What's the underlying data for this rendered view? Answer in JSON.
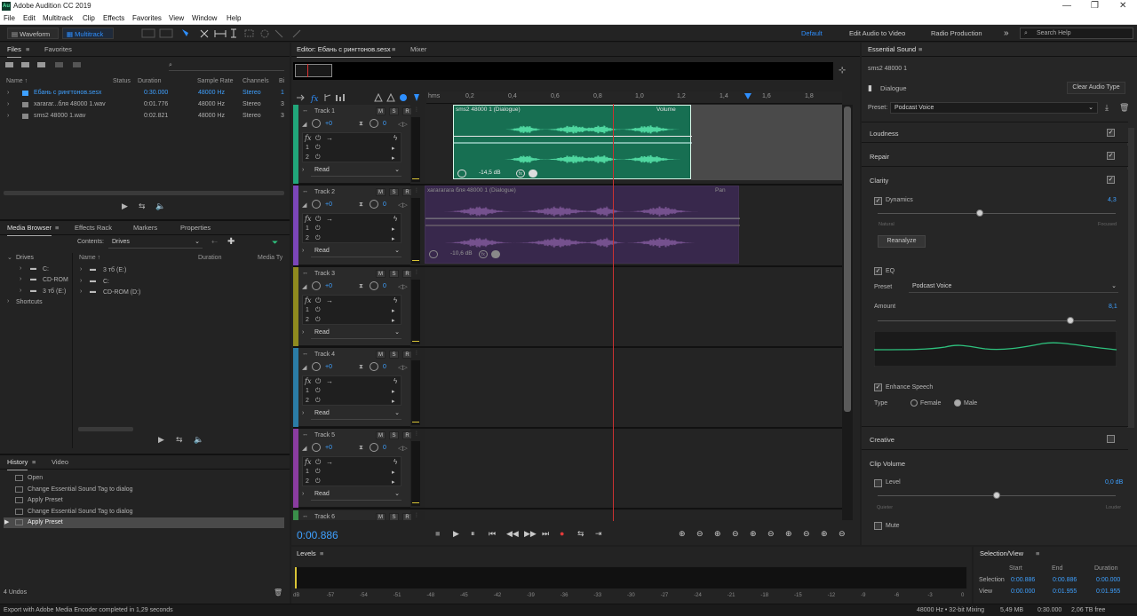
{
  "app": {
    "title": "Adobe Audition CC 2019",
    "logo": "Au",
    "window_controls": [
      "—",
      "❐",
      "✕"
    ]
  },
  "menu": [
    "File",
    "Edit",
    "Multitrack",
    "Clip",
    "Effects",
    "Favorites",
    "View",
    "Window",
    "Help"
  ],
  "toolbar": {
    "waveform": "Waveform",
    "multitrack": "Multitrack",
    "workspaces": [
      "Default",
      "Edit Audio to Video",
      "Radio Production"
    ],
    "more": "»",
    "search_placeholder": "Search Help"
  },
  "files_panel": {
    "tabs": [
      "Files",
      "Favorites"
    ],
    "columns": [
      "Name ↑",
      "Status",
      "Duration",
      "Sample Rate",
      "Channels",
      "Bi"
    ],
    "search_icon": "⌕",
    "rows": [
      {
        "name": "Ебань с рингтонов.sesx",
        "status": "",
        "duration": "0:30.000",
        "rate": "48000 Hz",
        "channels": "Stereo",
        "bits": "1",
        "highlight": true
      },
      {
        "name": "хагагаг...бля 48000 1.wav",
        "status": "",
        "duration": "0:01.776",
        "rate": "48000 Hz",
        "channels": "Stereo",
        "bits": "3",
        "highlight": false
      },
      {
        "name": "sms2 48000 1.wav",
        "status": "",
        "duration": "0:02.821",
        "rate": "48000 Hz",
        "channels": "Stereo",
        "bits": "3",
        "highlight": false
      }
    ],
    "transport_icons": [
      "▶",
      "⇆",
      "🔈"
    ]
  },
  "media_browser": {
    "tabs": [
      "Media Browser",
      "Effects Rack",
      "Markers",
      "Properties"
    ],
    "contents_label": "Contents:",
    "contents_value": "Drives",
    "tree": [
      {
        "label": "Drives",
        "indent": 0,
        "arrow": "⌄",
        "icon": ""
      },
      {
        "label": "C:",
        "indent": 1,
        "arrow": "›",
        "icon": "▬"
      },
      {
        "label": "CD-ROM",
        "indent": 1,
        "arrow": "›",
        "icon": "▬"
      },
      {
        "label": "3 тб (E:)",
        "indent": 1,
        "arrow": "›",
        "icon": "▬"
      },
      {
        "label": "Shortcuts",
        "indent": 0,
        "arrow": "›",
        "icon": ""
      }
    ],
    "columns": [
      "Name ↑",
      "Duration",
      "Media Ty"
    ],
    "list": [
      "3 тб (E:)",
      "C:",
      "CD-ROM (D:)"
    ],
    "transport_icons": [
      "▶",
      "⇆",
      "🔈"
    ]
  },
  "history_panel": {
    "tabs": [
      "History",
      "Video"
    ],
    "items": [
      "Open",
      "Change Essential Sound Tag to dialog",
      "Apply Preset",
      "Change Essential Sound Tag to dialog",
      "Apply Preset"
    ],
    "undos": "4 Undos",
    "trash_icon": "🗑"
  },
  "status_bar": {
    "message": "Export with Adobe Media Encoder completed in 1,29 seconds",
    "sample": "48000 Hz • 32-bit Mixing",
    "mem": "5,49 MB",
    "duration": "0:30.000",
    "free": "2,06 TB free"
  },
  "editor": {
    "tabs": [
      "Editor: Ебань с рингтонов.sesx",
      "Mixer"
    ],
    "ruler_unit": "hms",
    "ruler_ticks": [
      "0,2",
      "0,4",
      "0,6",
      "0,8",
      "1,0",
      "1,2",
      "1,4",
      "1,6",
      "1,8"
    ],
    "current_time": "0:00.886",
    "tracks": [
      {
        "name": "Track 1",
        "color": "#21a67a",
        "vol": "+0",
        "pan": "0",
        "mode": "Read",
        "clip": "sms2 48000 1 (Dialogue)",
        "clip_right": "Volume",
        "clip_db": "-14,5 dB"
      },
      {
        "name": "Track 2",
        "color": "#7b46b8",
        "vol": "+0",
        "pan": "0",
        "mode": "Read",
        "clip": "хагагагага бля 48000 1 (Dialogue)",
        "clip_right": "Pan",
        "clip_db": "-10,6 dB"
      },
      {
        "name": "Track 3",
        "color": "#8f8a1f",
        "vol": "+0",
        "pan": "0",
        "mode": "Read",
        "clip": "",
        "clip_right": "",
        "clip_db": ""
      },
      {
        "name": "Track 4",
        "color": "#2b7ca6",
        "vol": "+0",
        "pan": "0",
        "mode": "Read",
        "clip": "",
        "clip_right": "",
        "clip_db": ""
      },
      {
        "name": "Track 5",
        "color": "#8a3ca0",
        "vol": "+0",
        "pan": "0",
        "mode": "Read",
        "clip": "",
        "clip_right": "",
        "clip_db": ""
      },
      {
        "name": "Track 6",
        "color": "#3a8f4a",
        "vol": "",
        "pan": "",
        "mode": "",
        "clip": "",
        "clip_right": "",
        "clip_db": ""
      }
    ],
    "msr": [
      "M",
      "S",
      "R"
    ],
    "fx_row": [
      "1",
      "2"
    ],
    "transport_icons": [
      "■",
      "▶",
      "⏸",
      "⏮",
      "◀◀",
      "▶▶",
      "⏭",
      "●",
      "⇆",
      "⇥"
    ],
    "zoom_icons": [
      "⊕",
      "⊖",
      "⊕",
      "⊖",
      "⊕",
      "⊖",
      "⊕",
      "⊖",
      "⊕",
      "⊖"
    ]
  },
  "levels": {
    "title": "Levels",
    "ticks": [
      "dB",
      "-57",
      "-54",
      "-51",
      "-48",
      "-45",
      "-42",
      "-39",
      "-36",
      "-33",
      "-30",
      "-27",
      "-24",
      "-21",
      "-18",
      "-15",
      "-12",
      "-9",
      "-6",
      "-3",
      "0"
    ]
  },
  "selection_view": {
    "title": "Selection/View",
    "headers": [
      "Start",
      "End",
      "Duration"
    ],
    "selection": {
      "label": "Selection",
      "start": "0:00.886",
      "end": "0:00.886",
      "duration": "0:00.000"
    },
    "view": {
      "label": "View",
      "start": "0:00.000",
      "end": "0:01.955",
      "duration": "0:01.955"
    }
  },
  "essential_sound": {
    "title": "Essential Sound",
    "clip_name": "sms2 48000 1",
    "type": "Dialogue",
    "clear_btn": "Clear Audio Type",
    "preset_label": "Preset:",
    "preset_value": "Podcast Voice",
    "sections": {
      "loudness": "Loudness",
      "repair": "Repair",
      "clarity": "Clarity",
      "creative": "Creative",
      "clip_volume": "Clip Volume"
    },
    "dynamics": {
      "label": "Dynamics",
      "value": "4,3",
      "min": "Natural",
      "max": "Focused",
      "level": 0.43
    },
    "reanalyze": "Reanalyze",
    "eq": {
      "label": "EQ",
      "preset_label": "Preset",
      "preset_value": "Podcast Voice",
      "amount_label": "Amount",
      "amount_value": "8,1",
      "level": 0.81
    },
    "enhance": {
      "label": "Enhance Speech",
      "type_label": "Type",
      "female": "Female",
      "male": "Male"
    },
    "level": {
      "label": "Level",
      "value": "0,0 dB",
      "min": "Quieter",
      "max": "Louder",
      "level": 0.5
    },
    "mute": "Mute"
  }
}
